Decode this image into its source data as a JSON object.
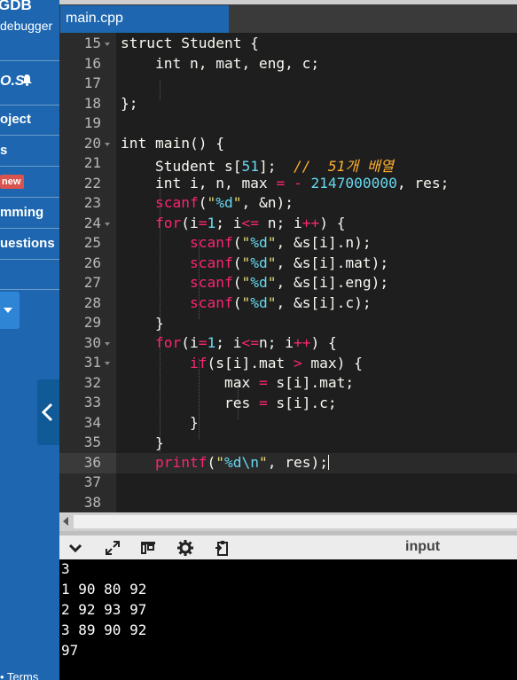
{
  "sidebar": {
    "brand": "GDB",
    "subtitle": "debugger",
    "badge": "O.S",
    "items": [
      "oject",
      "s",
      "mming",
      "uestions"
    ],
    "new_label": "new",
    "terms": "• Terms"
  },
  "editor": {
    "tab": "main.cpp",
    "lines": [
      {
        "n": "15"
      },
      {
        "n": "16"
      },
      {
        "n": "17"
      },
      {
        "n": "18"
      },
      {
        "n": "19"
      },
      {
        "n": "20"
      },
      {
        "n": "21"
      },
      {
        "n": "22"
      },
      {
        "n": "23"
      },
      {
        "n": "24"
      },
      {
        "n": "25"
      },
      {
        "n": "26"
      },
      {
        "n": "27"
      },
      {
        "n": "28"
      },
      {
        "n": "29"
      },
      {
        "n": "30"
      },
      {
        "n": "31"
      },
      {
        "n": "32"
      },
      {
        "n": "33"
      },
      {
        "n": "34"
      },
      {
        "n": "35"
      },
      {
        "n": "36"
      },
      {
        "n": "37"
      },
      {
        "n": "38"
      }
    ],
    "code": {
      "l15": "struct Student {",
      "l16": "    int n, mat, eng, c;",
      "l18": "};",
      "l20": "int main() {",
      "l21a": "    Student s[",
      "l21b": "51",
      "l21c": "];  ",
      "l21d": "//  51개 배열",
      "l22a": "    int i, n, max ",
      "l22b": "=",
      "l22c": " ",
      "l22d": "-",
      "l22e": " ",
      "l22f": "2147000000",
      "l22g": ", res;",
      "scanf": "scanf",
      "printf": "printf",
      "for": "for",
      "if": "if",
      "q": "\"",
      "fmt_d": "%d",
      "fmt_nl": "\\n",
      "l23tail": ", &n);",
      "l24a": "(i",
      "l24b": "=",
      "l24c": "1",
      "l24d": "; i",
      "l24e": "<=",
      "l24f": " n; i",
      "l24g": "++",
      "l24h": ") {",
      "l25tail": ", &s[i].n);",
      "l26tail": ", &s[i].mat);",
      "l27tail": ", &s[i].eng);",
      "l28tail": ", &s[i].c);",
      "l29": "    }",
      "l30a": "(i",
      "l30e": "<=",
      "l30f": "n; i",
      "l31a": "(s[i].mat ",
      "l31b": ">",
      "l31c": " max) {",
      "l32a": "            max ",
      "l32b": "=",
      "l32c": " s[i].mat;",
      "l33a": "            res ",
      "l33c": " s[i].c;",
      "l34": "        }",
      "l35": "    }",
      "l36tail": ", res);",
      "paren": "(",
      "sp4": "    ",
      "sp8": "        "
    }
  },
  "panel": {
    "input_label": "input",
    "output": [
      "3",
      "1 90 80 92",
      "2 92 93 97",
      "3 89 90 92",
      "97"
    ]
  }
}
